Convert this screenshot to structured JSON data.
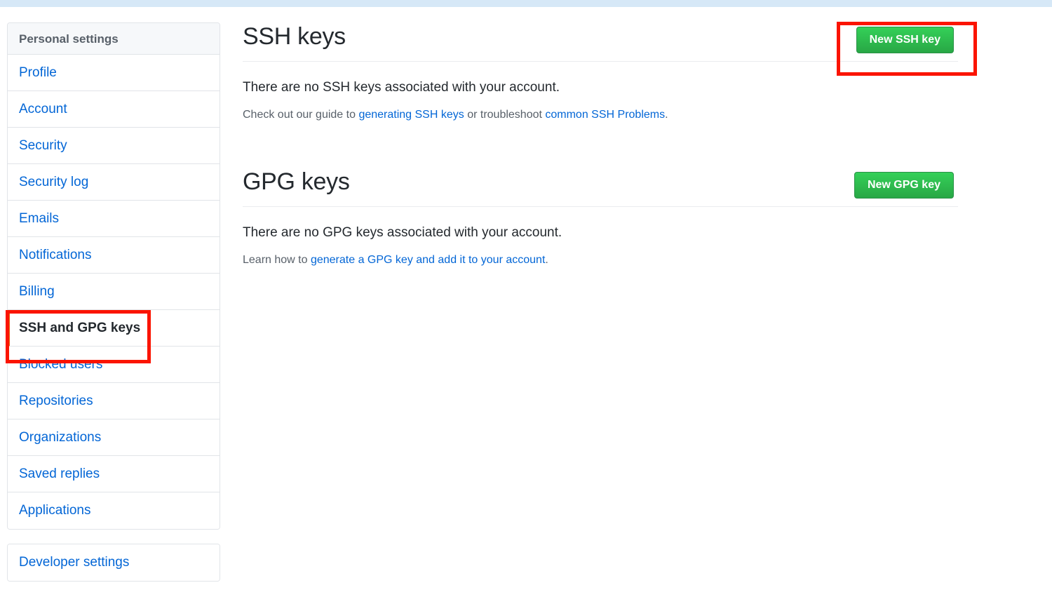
{
  "sidebar": {
    "header": "Personal settings",
    "items": [
      {
        "label": "Profile",
        "name": "sidebar-item-profile",
        "selected": false
      },
      {
        "label": "Account",
        "name": "sidebar-item-account",
        "selected": false
      },
      {
        "label": "Security",
        "name": "sidebar-item-security",
        "selected": false
      },
      {
        "label": "Security log",
        "name": "sidebar-item-security-log",
        "selected": false
      },
      {
        "label": "Emails",
        "name": "sidebar-item-emails",
        "selected": false
      },
      {
        "label": "Notifications",
        "name": "sidebar-item-notifications",
        "selected": false
      },
      {
        "label": "Billing",
        "name": "sidebar-item-billing",
        "selected": false
      },
      {
        "label": "SSH and GPG keys",
        "name": "sidebar-item-ssh-and-gpg-keys",
        "selected": true
      },
      {
        "label": "Blocked users",
        "name": "sidebar-item-blocked-users",
        "selected": false
      },
      {
        "label": "Repositories",
        "name": "sidebar-item-repositories",
        "selected": false
      },
      {
        "label": "Organizations",
        "name": "sidebar-item-organizations",
        "selected": false
      },
      {
        "label": "Saved replies",
        "name": "sidebar-item-saved-replies",
        "selected": false
      },
      {
        "label": "Applications",
        "name": "sidebar-item-applications",
        "selected": false
      }
    ],
    "developer_settings": "Developer settings"
  },
  "ssh_section": {
    "title": "SSH keys",
    "button_label": "New SSH key",
    "empty_message": "There are no SSH keys associated with your account.",
    "help_prefix": "Check out our guide to ",
    "help_link_1": "generating SSH keys",
    "help_middle": " or troubleshoot ",
    "help_link_2": "common SSH Problems",
    "help_suffix": "."
  },
  "gpg_section": {
    "title": "GPG keys",
    "button_label": "New GPG key",
    "empty_message": "There are no GPG keys associated with your account.",
    "help_prefix": "Learn how to ",
    "help_link_1": "generate a GPG key and add it to your account",
    "help_suffix": "."
  },
  "colors": {
    "link_blue": "#0366d6",
    "button_green": "#2cbe4e",
    "active_orange": "#e36209",
    "annotation_red": "#fb1400",
    "header_gray": "#f6f8fa",
    "top_strip_blue": "#d6e8f7"
  }
}
